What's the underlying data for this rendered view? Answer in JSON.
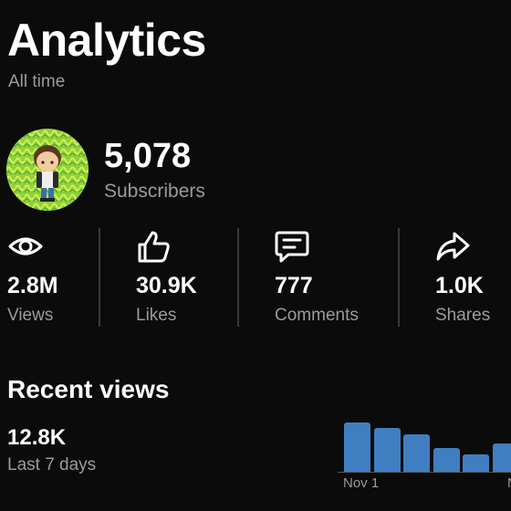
{
  "header": {
    "title": "Analytics",
    "period": "All time"
  },
  "channel": {
    "subscriber_count": "5,078",
    "subscriber_label": "Subscribers"
  },
  "stats": [
    {
      "icon": "eye-icon",
      "value": "2.8M",
      "label": "Views"
    },
    {
      "icon": "thumbs-up-icon",
      "value": "30.9K",
      "label": "Likes"
    },
    {
      "icon": "comment-icon",
      "value": "777",
      "label": "Comments"
    },
    {
      "icon": "share-icon",
      "value": "1.0K",
      "label": "Shares"
    }
  ],
  "recent_views": {
    "title": "Recent views",
    "count": "12.8K",
    "period_label": "Last 7 days",
    "bar_color": "#3f7fc1",
    "chart_data": {
      "type": "bar",
      "relative_values": [
        1.0,
        0.88,
        0.75,
        0.48,
        0.36,
        0.57
      ],
      "tick_labels": [
        "Nov 1",
        "N"
      ],
      "note": "bars clipped at right edge"
    }
  },
  "colors": {
    "background": "#0b0b0b",
    "primary_text": "#ffffff",
    "secondary_text": "#9b9b9b",
    "divider": "#3a3a3a"
  }
}
